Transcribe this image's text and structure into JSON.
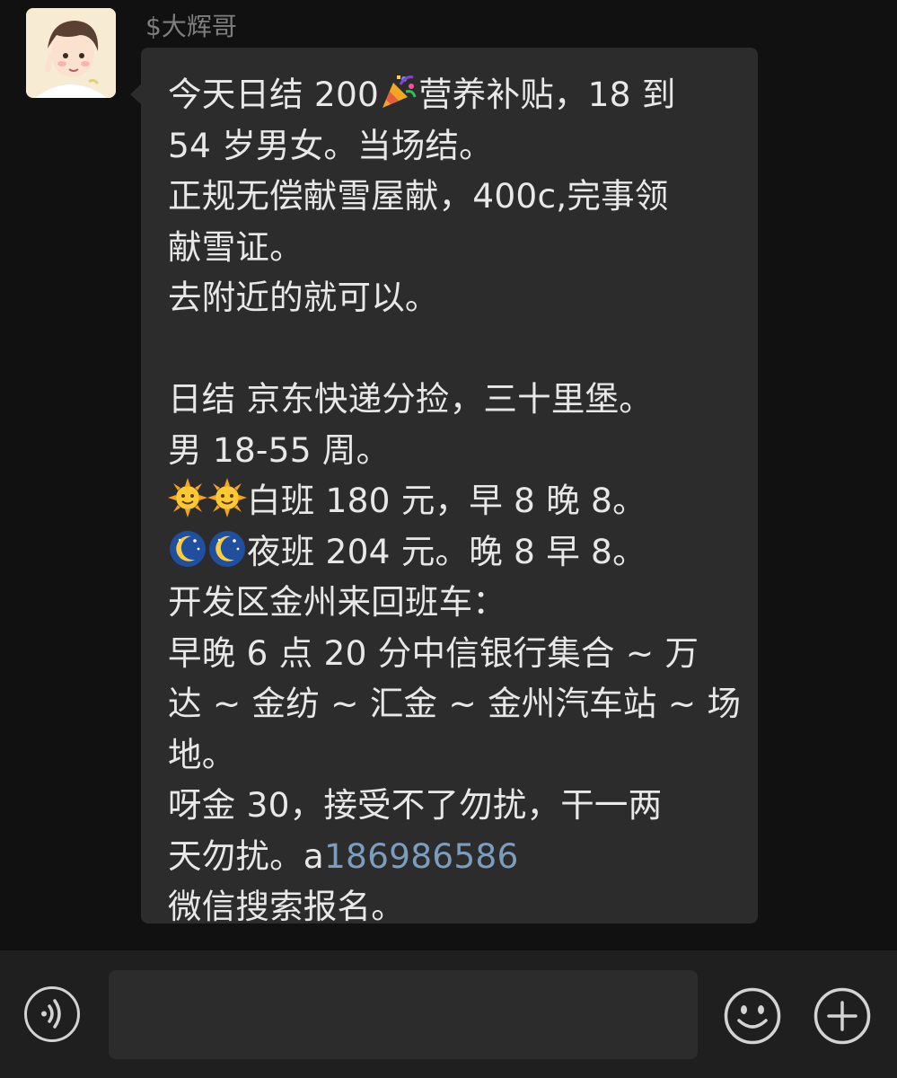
{
  "chat": {
    "sender_name": "$大辉哥",
    "message": {
      "line1_a": "今天日结 200",
      "line1_b": "营养补贴，18 到",
      "line2": "54 岁男女。当场结。",
      "line3": "正规无偿献雪屋献，400c,完事领",
      "line4": "献雪证。",
      "line5": "去附近的就可以。",
      "line7": "日结 京东快递分捡，三十里堡。",
      "line8": "男 18-55 周。",
      "line9": "白班 180 元，早 8 晚 8。",
      "line10": "夜班 204 元。晚 8 早 8。",
      "line11": "开发区金州来回班车：",
      "line12": "早晚 6 点 20 分中信银行集合 ~ 万",
      "line13": "达 ~ 金纺 ~ 汇金 ~ 金州汽车站 ~ 场",
      "line14": "地。",
      "line15": "呀金 30，接受不了勿扰，干一两",
      "line16_a": "天勿扰。a",
      "line16_phone": "186986586",
      "line17": "微信搜索报名。"
    },
    "icons": {
      "party": "party-popper-icon",
      "sun": "sun-with-face-icon",
      "moon": "crescent-moon-with-stars-icon"
    }
  },
  "input_bar": {
    "voice_icon": "voice-icon",
    "emoji_icon": "smiley-face-icon",
    "plus_icon": "plus-icon",
    "placeholder": ""
  },
  "colors": {
    "background": "#111111",
    "bubble": "#2c2c2c",
    "text": "#e8e8e8",
    "link": "#7d9dbf",
    "sender": "#7e7e7e"
  }
}
